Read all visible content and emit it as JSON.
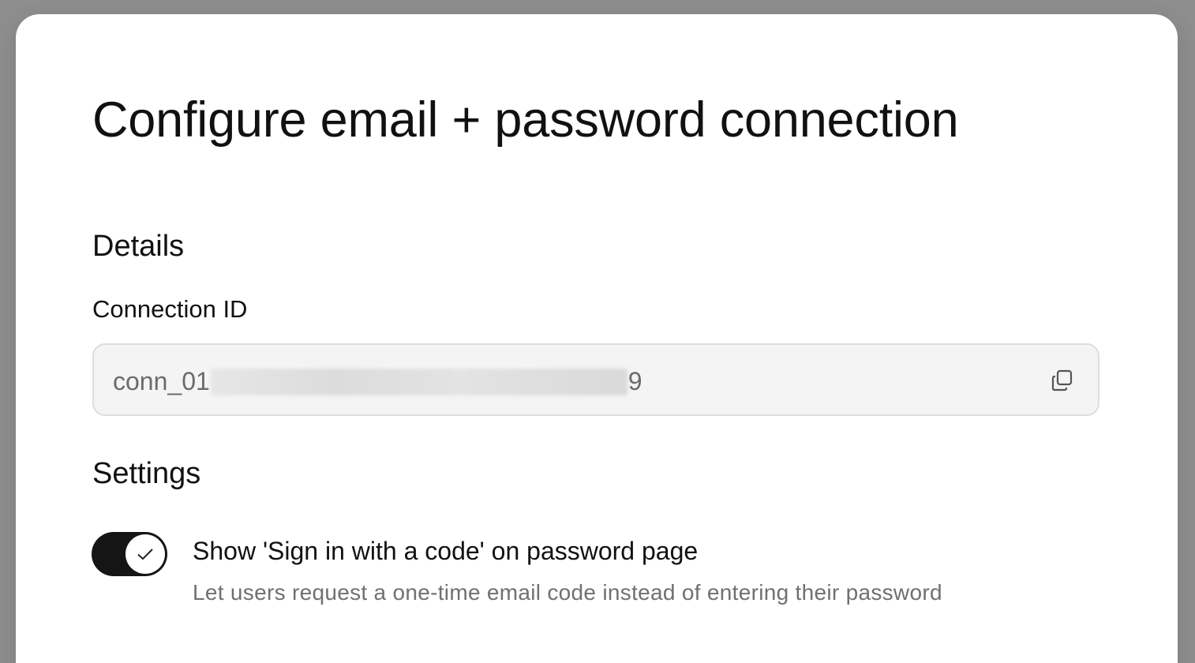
{
  "modal": {
    "title": "Configure email + password connection"
  },
  "details": {
    "heading": "Details",
    "connection_id_label": "Connection ID",
    "connection_id_prefix": "conn_01",
    "connection_id_suffix": "9",
    "copy_icon": "copy-icon"
  },
  "settings": {
    "heading": "Settings",
    "toggle": {
      "enabled": true,
      "label": "Show 'Sign in with a code' on password page",
      "description": "Let users request a one-time email code instead of entering their password"
    }
  },
  "colors": {
    "toggle_on": "#151515",
    "field_background": "#f4f4f4",
    "overlay": "#8e8e8e"
  }
}
